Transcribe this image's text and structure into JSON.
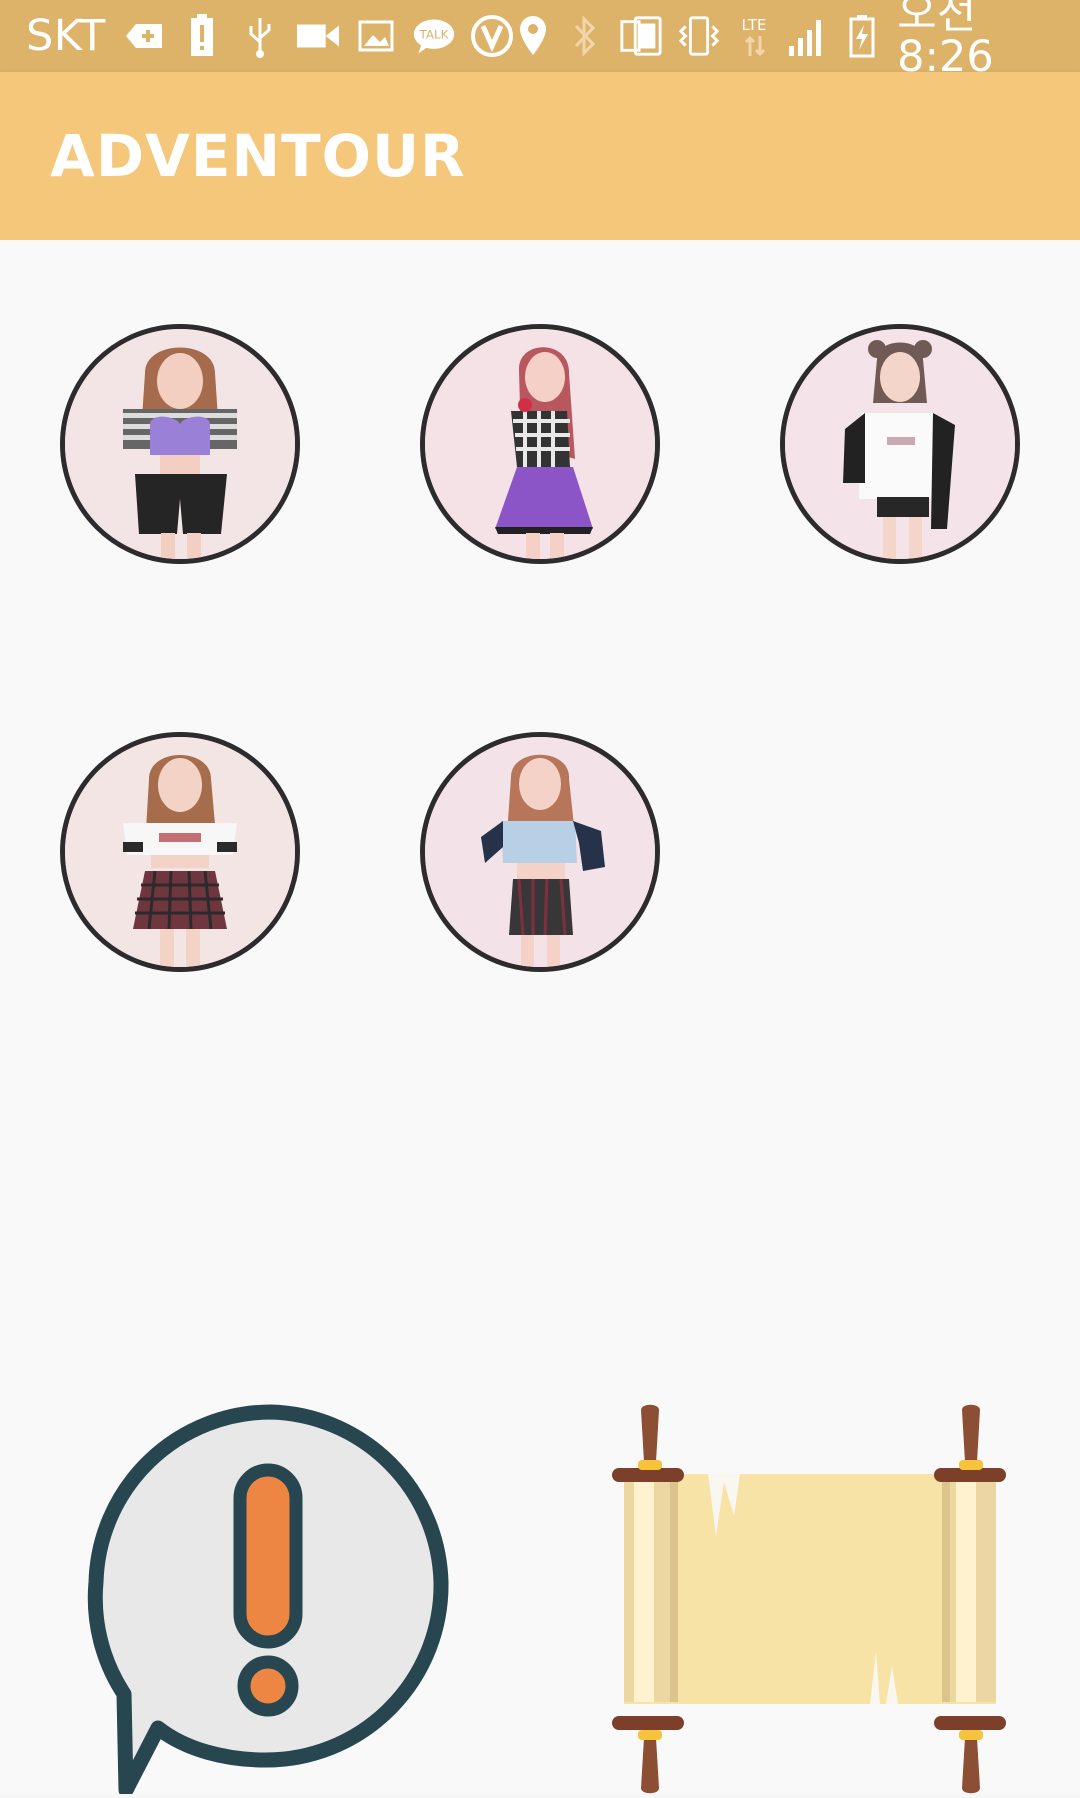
{
  "status_bar": {
    "carrier": "SKT",
    "time": "오전 8:26",
    "icons": [
      "usb-debug-icon",
      "battery-alert-icon",
      "usb-icon",
      "video-icon",
      "image-icon",
      "kakaotalk-icon",
      "v-app-icon",
      "location-icon",
      "bluetooth-icon",
      "screen-cast-icon",
      "vibrate-icon",
      "lte-icon",
      "signal-icon",
      "battery-charging-icon"
    ]
  },
  "app_bar": {
    "title": "ADVENTOUR"
  },
  "members": [
    {
      "icon": "member-avatar-1"
    },
    {
      "icon": "member-avatar-2"
    },
    {
      "icon": "member-avatar-3"
    },
    {
      "icon": "member-avatar-4"
    },
    {
      "icon": "member-avatar-5"
    }
  ],
  "bottom_actions": {
    "notice_icon": "alert-speech-bubble-icon",
    "scroll_icon": "scroll-icon"
  },
  "colors": {
    "status_bar": "#ddb36a",
    "app_bar": "#f5c77b",
    "background": "#f9f9f9",
    "avatar_border": "#2d2b2d"
  }
}
